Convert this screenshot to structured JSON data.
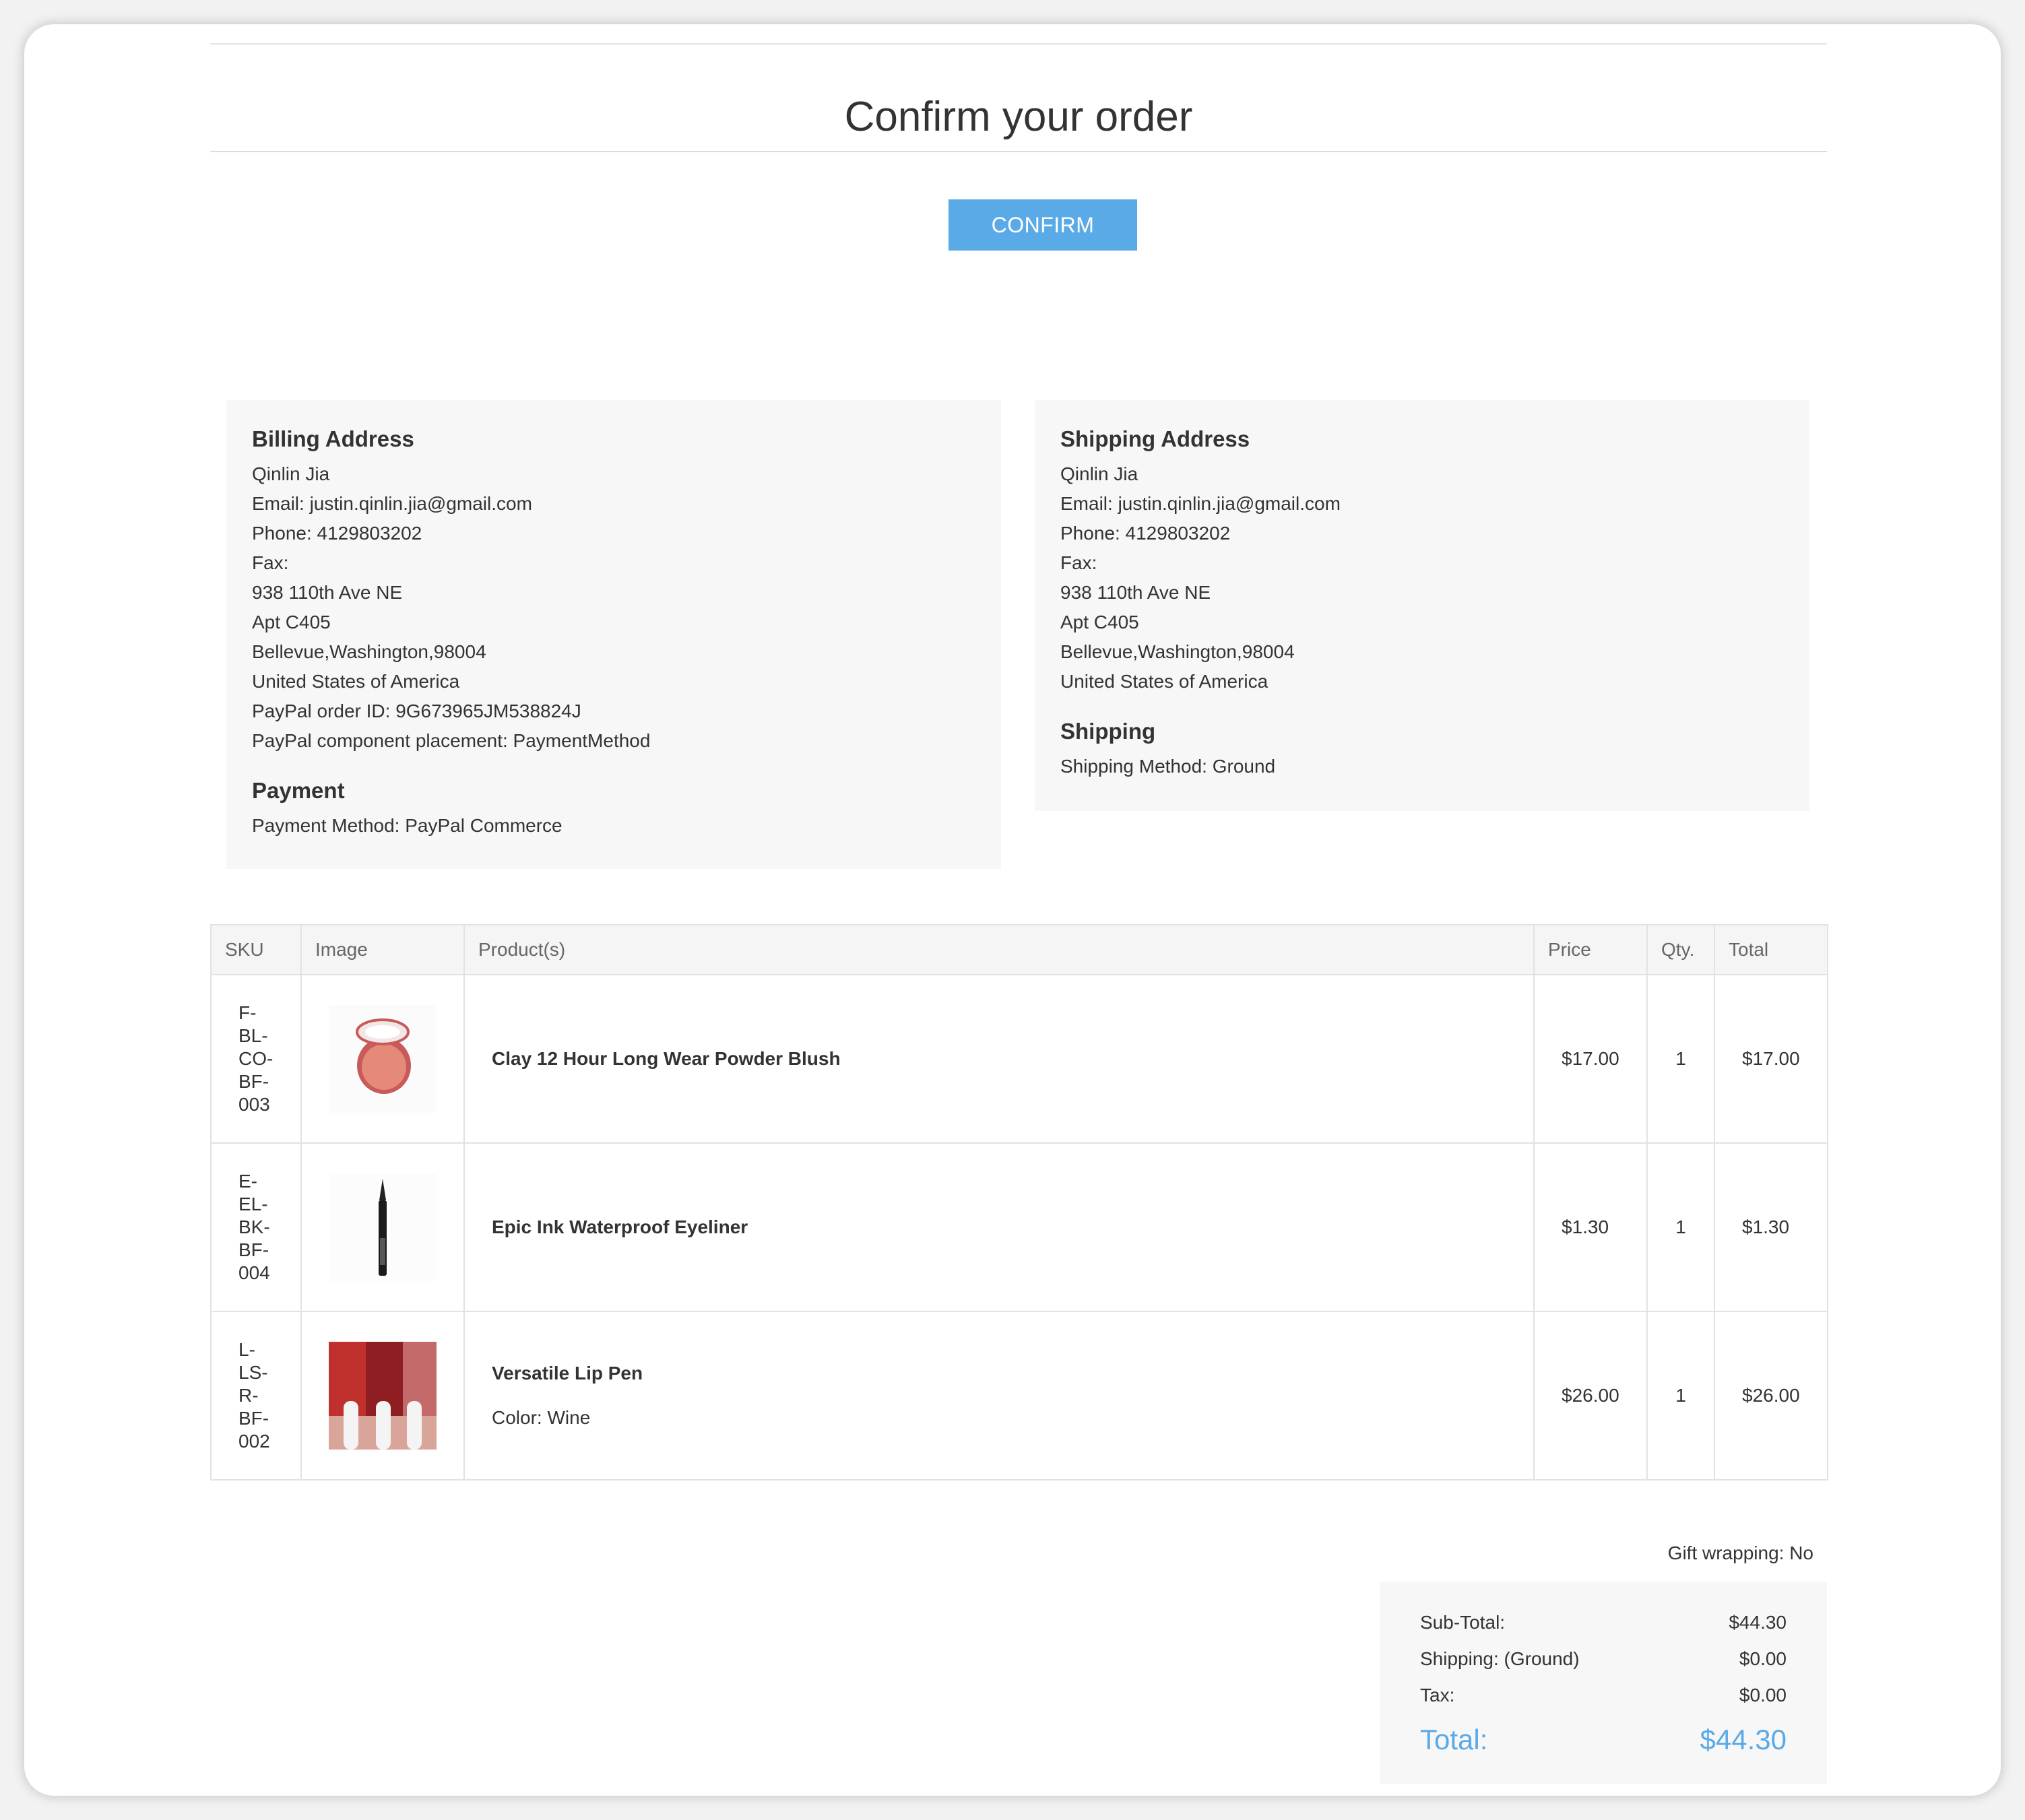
{
  "page": {
    "title": "Confirm your order",
    "confirm_label": "CONFIRM"
  },
  "billing": {
    "heading": "Billing Address",
    "lines": [
      "Qinlin Jia",
      "Email: justin.qinlin.jia@gmail.com",
      "Phone: 4129803202",
      "Fax:",
      "938 110th Ave NE",
      "Apt C405",
      "Bellevue,Washington,98004",
      "United States of America",
      "PayPal order ID: 9G673965JM538824J",
      "PayPal component placement: PaymentMethod"
    ],
    "payment_heading": "Payment",
    "payment_method": "Payment Method: PayPal Commerce"
  },
  "shipping": {
    "heading": "Shipping Address",
    "lines": [
      "Qinlin Jia",
      "Email: justin.qinlin.jia@gmail.com",
      "Phone: 4129803202",
      "Fax:",
      "938 110th Ave NE",
      "Apt C405",
      "Bellevue,Washington,98004",
      "United States of America"
    ],
    "method_heading": "Shipping",
    "method": "Shipping Method: Ground"
  },
  "table": {
    "headers": [
      "SKU",
      "Image",
      "Product(s)",
      "Price",
      "Qty.",
      "Total"
    ],
    "rows": [
      {
        "sku_parts": [
          "F-",
          "BL-",
          "CO-",
          "BF-",
          "003"
        ],
        "image_icon": "blush-compact-image",
        "name": "Clay 12 Hour Long Wear Powder Blush",
        "option": "",
        "price": "$17.00",
        "qty": "1",
        "total": "$17.00"
      },
      {
        "sku_parts": [
          "E-",
          "EL-",
          "BK-",
          "BF-",
          "004"
        ],
        "image_icon": "eyeliner-image",
        "name": "Epic Ink Waterproof Eyeliner",
        "option": "",
        "price": "$1.30",
        "qty": "1",
        "total": "$1.30"
      },
      {
        "sku_parts": [
          "L-",
          "LS-",
          "R-",
          "BF-",
          "002"
        ],
        "image_icon": "lip-pens-image",
        "name": "Versatile Lip Pen",
        "option": "Color: Wine",
        "price": "$26.00",
        "qty": "1",
        "total": "$26.00"
      }
    ]
  },
  "gift_wrapping": "Gift wrapping: No",
  "totals": {
    "subtotal_label": "Sub-Total:",
    "subtotal_value": "$44.30",
    "shipping_label": "Shipping: (Ground)",
    "shipping_value": "$0.00",
    "tax_label": "Tax:",
    "tax_value": "$0.00",
    "total_label": "Total:",
    "total_value": "$44.30"
  },
  "colors": {
    "accent": "#5aaae7",
    "panel_bg": "#f7f7f7",
    "border": "#e2e2e2"
  }
}
